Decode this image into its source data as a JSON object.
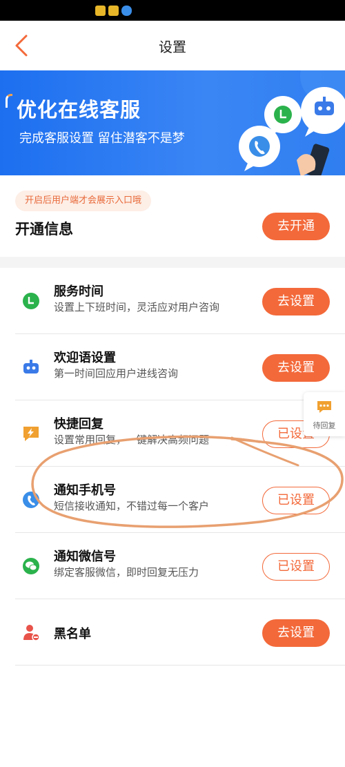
{
  "nav": {
    "title": "设置"
  },
  "banner": {
    "title": "优化在线客服",
    "subtitle": "完成客服设置 留住潜客不是梦"
  },
  "notice": {
    "pill": "开启后用户端才会展示入口哦",
    "title": "开通信息",
    "button": "去开通"
  },
  "items": [
    {
      "title": "服务时间",
      "desc": "设置上下班时间，灵活应对用户咨询",
      "button": "去设置",
      "state": "unset",
      "icon": "clock-icon",
      "color": "#2bb24c"
    },
    {
      "title": "欢迎语设置",
      "desc": "第一时间回应用户进线咨询",
      "button": "去设置",
      "state": "unset",
      "icon": "robot-icon",
      "color": "#3a7ae8"
    },
    {
      "title": "快捷回复",
      "desc": "设置常用回复，一键解决高频问题",
      "button": "已设置",
      "state": "set",
      "icon": "lightning-icon",
      "color": "#f0a030"
    },
    {
      "title": "通知手机号",
      "desc": "短信接收通知，不错过每一个客户",
      "button": "已设置",
      "state": "set",
      "icon": "phone-icon",
      "color": "#3a8ee8"
    },
    {
      "title": "通知微信号",
      "desc": "绑定客服微信，即时回复无压力",
      "button": "已设置",
      "state": "set",
      "icon": "wechat-icon",
      "color": "#2bb24c"
    },
    {
      "title": "黑名单",
      "desc": "",
      "button": "去设置",
      "state": "unset",
      "icon": "blocked-user-icon",
      "color": "#e8534a"
    }
  ],
  "float_reply": {
    "label": "待回复",
    "icon": "chat-bubble-icon"
  },
  "colors": {
    "accent": "#f3693a",
    "banner": "#2f7ef0",
    "annotation": "#e8a070"
  }
}
